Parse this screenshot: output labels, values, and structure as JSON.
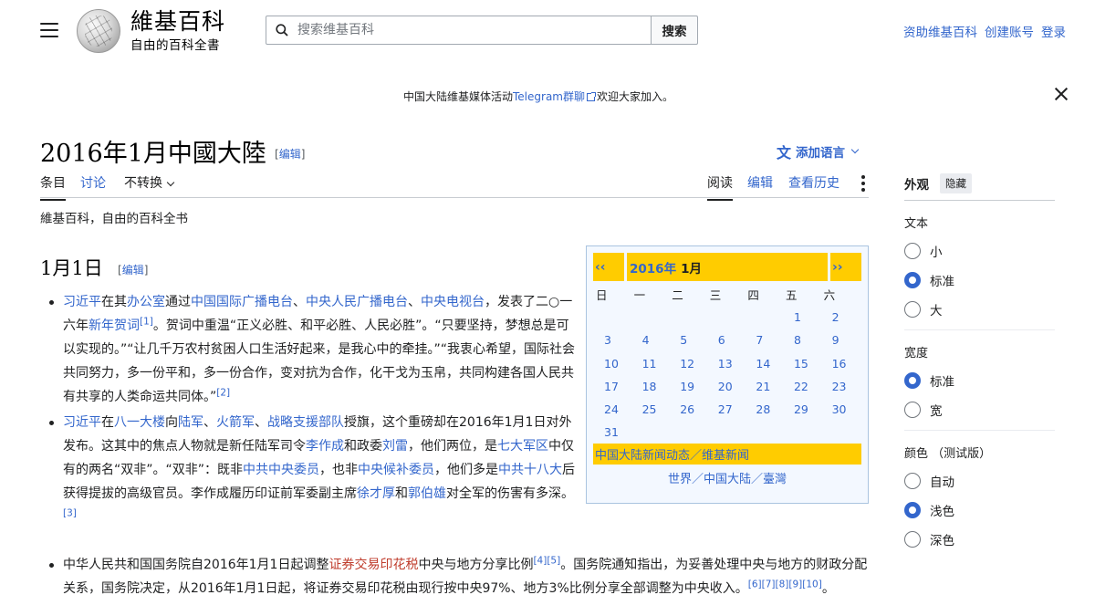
{
  "header": {
    "logo_wordmark": "維基百科",
    "logo_tagline": "自由的百科全書",
    "search_placeholder": "搜索维基百科",
    "search_button": "搜索",
    "user_links": [
      "资助维基百科",
      "创建账号",
      "登录"
    ]
  },
  "notice": {
    "before": "中国大陆维基媒体活动",
    "link": "Telegram群聊",
    "after": "欢迎大家加入。"
  },
  "page": {
    "title": "2016年1月中國大陸",
    "edit_label": "[编辑]",
    "add_language": "添加语言",
    "site_sub": "維基百科，自由的百科全书"
  },
  "tabs": {
    "left": [
      "条目",
      "讨论",
      "不转换"
    ],
    "right": [
      "阅读",
      "编辑",
      "查看历史"
    ]
  },
  "section": {
    "heading": "1月1日",
    "edit_label": "[编辑]"
  },
  "content": {
    "item1": {
      "a": "习近平",
      "b": "在其",
      "c": "办公室",
      "d": "通过",
      "e": "中国国际广播电台",
      "f": "、",
      "g": "中央人民广播电台",
      "h": "、",
      "i": "中央电视台",
      "j": "，发表了二○一六年",
      "k": "新年贺词",
      "ref1": "[1]",
      "l": "。贺词中重温“正义必胜、和平必胜、人民必胜”。“只要坚持，梦想总是可以实现的。”“让几千万农村贫困人口生活好起来，是我心中的牵挂。”“我衷心希望，国际社会共同努力，多一份平和，多一份合作，变对抗为合作，化干戈为玉帛，共同构建各国人民共有共享的人类命运共同体。”",
      "ref2": "[2]"
    },
    "item2": {
      "a": "习近平",
      "b": "在",
      "c": "八一大楼",
      "d": "向",
      "e": "陆军",
      "f": "、",
      "g": "火箭军",
      "h": "、",
      "i": "战略支援部队",
      "j": "授旗，这个重磅却在2016年1月1日对外发布。这其中的焦点人物就是新任陆军司令",
      "k": "李作成",
      "l": "和政委",
      "m": "刘雷",
      "n": "，他们两位，是",
      "o": "七大军区",
      "p": "中仅有的两名“双非”。“双非”：既非",
      "q": "中共中央委员",
      "r": "，也非",
      "s": "中央候补委员",
      "t": "，他们多是",
      "u": "中共十八大",
      "v": "后获得提拔的高级官员。李作成履历印证前军委副主席",
      "w": "徐才厚",
      "x": "和",
      "y": "郭伯雄",
      "z": "对全军的伤害有多深。",
      "ref3": "[3]"
    },
    "item3": {
      "a": "中华人民共和国国务院自2016年1月1日起调整",
      "b": "证券交易印花税",
      "c": "中央与地方分享比例",
      "ref": "[4][5]",
      "d": "。国务院通知指出，为妥善处理中央与地方的财政分配关系，国务院决定，从2016年1月1日起，将证券交易印花税由现行按中央97%、地方3%比例分享全部调整为中央收入。",
      "refs": "[6][7][8][9][10]",
      "e": "。"
    }
  },
  "calendar": {
    "prev": "‹‹",
    "next": "››",
    "year": "2016年",
    "month": "1月",
    "weekdays": [
      "日",
      "一",
      "二",
      "三",
      "四",
      "五",
      "六"
    ],
    "leading_blanks": 5,
    "days": [
      "1",
      "2",
      "3",
      "4",
      "5",
      "6",
      "7",
      "8",
      "9",
      "10",
      "11",
      "12",
      "13",
      "14",
      "15",
      "16",
      "17",
      "18",
      "19",
      "20",
      "21",
      "22",
      "23",
      "24",
      "25",
      "26",
      "27",
      "28",
      "29",
      "30",
      "31"
    ],
    "footer": "中国大陆新闻动态／维基新闻",
    "links": "世界／中国大陆／臺灣"
  },
  "appearance": {
    "title": "外观",
    "hide": "隐藏",
    "groups": [
      {
        "label": "文本",
        "options": [
          "小",
          "标准",
          "大"
        ],
        "selected": 1
      },
      {
        "label": "宽度",
        "options": [
          "标准",
          "宽"
        ],
        "selected": 0
      },
      {
        "label": "颜色 （测试版）",
        "options": [
          "自动",
          "浅色",
          "深色"
        ],
        "selected": 1
      }
    ]
  },
  "colors": {
    "link": "#3366cc",
    "redlink": "#bf3c2c",
    "calendar_accent": "#ffcc00",
    "radio_checked": "#3366cc"
  },
  "icons": [
    "menu-icon",
    "wikipedia-globe-icon",
    "search-icon",
    "external-link-icon",
    "close-icon",
    "language-icon",
    "chevron-down-icon",
    "more-vertical-icon"
  ]
}
